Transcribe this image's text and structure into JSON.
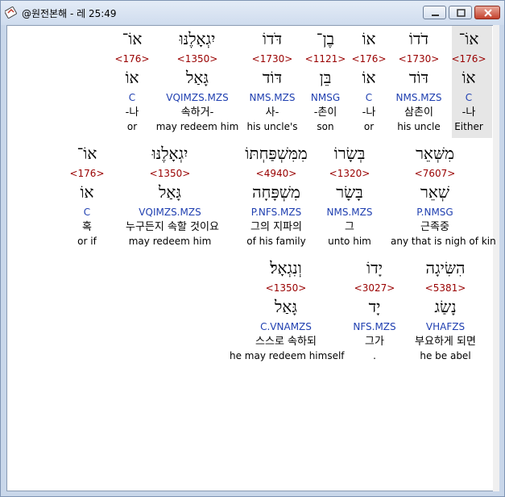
{
  "window": {
    "title": "@원전본해 - 레 25:49"
  },
  "lines": [
    [
      {
        "hebrew": "אוֹ־",
        "strong": "<176>",
        "lemma": "אוֹ",
        "morph": "C",
        "korean": "-나",
        "english": "Either"
      },
      {
        "hebrew": "דֹדוֹ",
        "strong": "<1730>",
        "lemma": "דּוֹד",
        "morph": "NMS.MZS",
        "korean": "삼촌이",
        "english": "his uncle"
      },
      {
        "hebrew": "אוֹ",
        "strong": "<176>",
        "lemma": "אוֹ",
        "morph": "C",
        "korean": "-나",
        "english": "or"
      },
      {
        "hebrew": "בֶן־",
        "strong": "<1121>",
        "lemma": "בֵּן",
        "morph": "NMSG",
        "korean": "-촌이",
        "english": "son"
      },
      {
        "hebrew": "דֹּדוֹ",
        "strong": "<1730>",
        "lemma": "דּוֹד",
        "morph": "NMS.MZS",
        "korean": "사-",
        "english": "his uncle's"
      },
      {
        "hebrew": "יִגְאָלֶנּוּ",
        "strong": "<1350>",
        "lemma": "גָּאַל",
        "morph": "VQIMZS.MZS",
        "korean": "속하거-",
        "english": "may redeem him"
      },
      {
        "hebrew": "אוֹ־",
        "strong": "<176>",
        "lemma": "אוֹ",
        "morph": "C",
        "korean": "-나",
        "english": "or"
      }
    ],
    [
      {
        "hebrew": "מִשְּׁאֵר",
        "strong": "<7607>",
        "lemma": "שְׁאֵר",
        "morph": "P.NMSG",
        "korean": "근족중",
        "english": "any that is nigh of kin"
      },
      {
        "hebrew": "בְּשָׂרוֹ",
        "strong": "<1320>",
        "lemma": "בָּשָׂר",
        "morph": "NMS.MZS",
        "korean": "그",
        "english": "unto him"
      },
      {
        "hebrew": "מִמִּשְׁפַּחְתּוֹ",
        "strong": "<4940>",
        "lemma": "מִשְׁפָּחָה",
        "morph": "P.NFS.MZS",
        "korean": "그의 지파의",
        "english": "of his family"
      },
      {
        "hebrew": "יִגְאָלֶנּוּ",
        "strong": "<1350>",
        "lemma": "גָּאַל",
        "morph": "VQIMZS.MZS",
        "korean": "누구든지 속할 것이요",
        "english": "may redeem him"
      },
      {
        "hebrew": "אוֹ־",
        "strong": "<176>",
        "lemma": "אוֹ",
        "morph": "C",
        "korean": "혹",
        "english": "or if"
      }
    ],
    [
      {
        "hebrew": "הִשִּׂיגָה",
        "strong": "<5381>",
        "lemma": "נָשַׂג",
        "morph": "VHAFZS",
        "korean": "부요하게 되면",
        "english": "he be abel"
      },
      {
        "hebrew": "יָדוֹ",
        "strong": "<3027>",
        "lemma": "יָד",
        "morph": "NFS.MZS",
        "korean": "그가",
        "english": "."
      },
      {
        "hebrew": "וְנִגְאָל׃",
        "strong": "<1350>",
        "lemma": "גָּאַל",
        "morph": "C.VNAMZS",
        "korean": "스스로 속하되",
        "english": "he may redeem himself"
      }
    ]
  ]
}
